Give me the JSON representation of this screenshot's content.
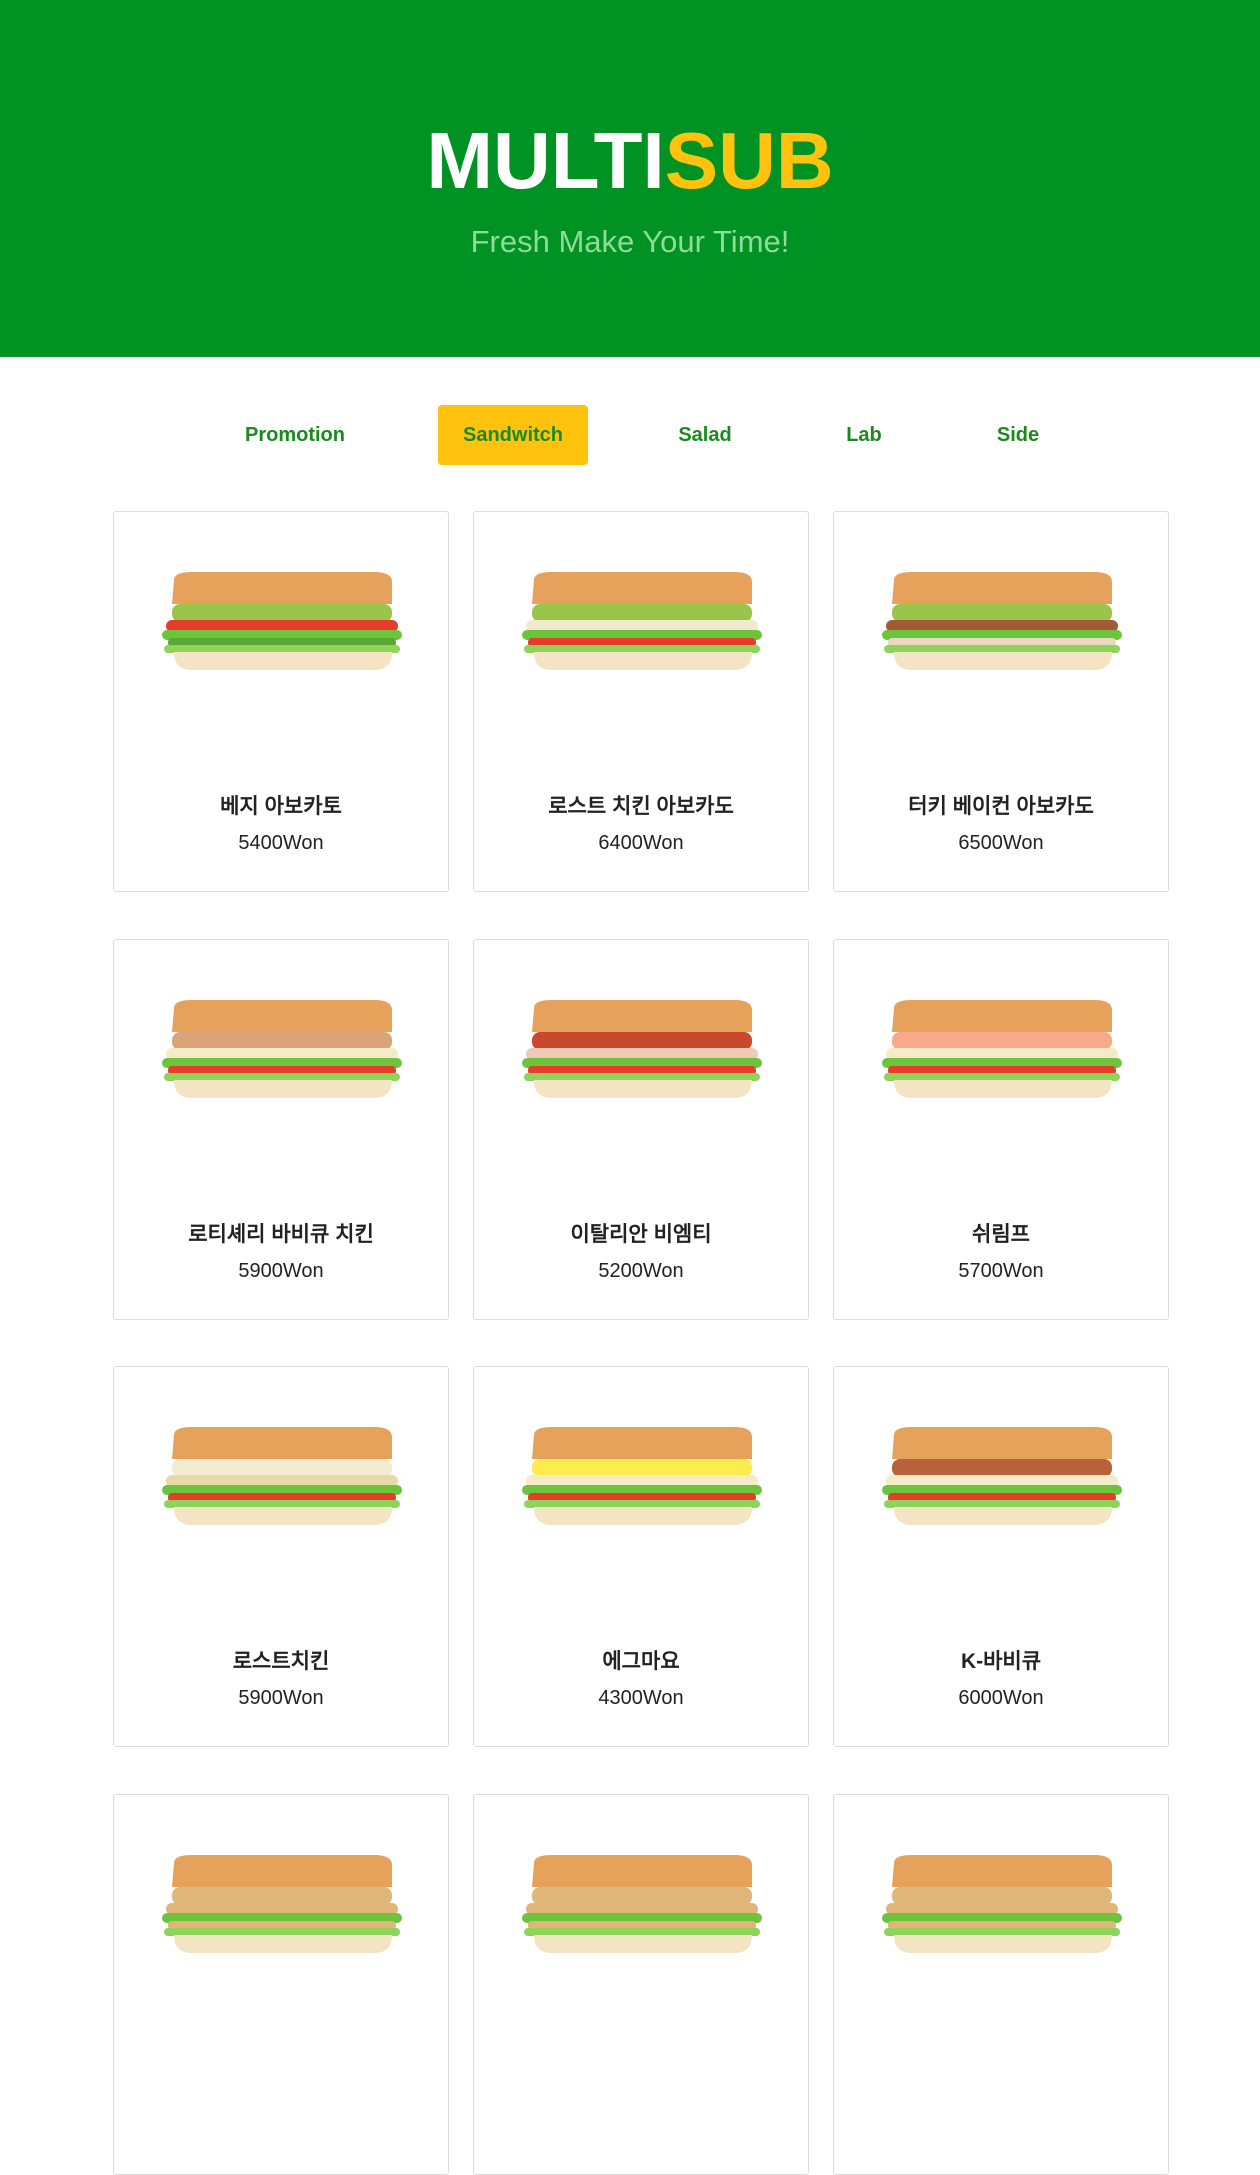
{
  "header": {
    "logo_part1": "MULTI",
    "logo_part2": "SUB",
    "tagline": "Fresh Make Your Time!",
    "bg_color": "#009223",
    "accent_color": "#ffc20e"
  },
  "tabs": [
    {
      "label": "Promotion",
      "active": false
    },
    {
      "label": "Sandwitch",
      "active": true
    },
    {
      "label": "Salad",
      "active": false
    },
    {
      "label": "Lab",
      "active": false
    },
    {
      "label": "Side",
      "active": false
    }
  ],
  "products": [
    {
      "name": "베지 아보카토",
      "price": "5400Won",
      "filling": "veggie-avocado"
    },
    {
      "name": "로스트 치킨 아보카도",
      "price": "6400Won",
      "filling": "chicken-avocado"
    },
    {
      "name": "터키 베이컨 아보카도",
      "price": "6500Won",
      "filling": "turkey-bacon-avocado"
    },
    {
      "name": "로티셰리 바비큐 치킨",
      "price": "5900Won",
      "filling": "rotisserie-bbq"
    },
    {
      "name": "이탈리안 비엠티",
      "price": "5200Won",
      "filling": "italian-bmt"
    },
    {
      "name": "쉬림프",
      "price": "5700Won",
      "filling": "shrimp"
    },
    {
      "name": "로스트치킨",
      "price": "5900Won",
      "filling": "roast-chicken"
    },
    {
      "name": "에그마요",
      "price": "4300Won",
      "filling": "egg-mayo"
    },
    {
      "name": "K-바비큐",
      "price": "6000Won",
      "filling": "k-bbq"
    },
    {
      "name": "",
      "price": "",
      "filling": "partial"
    },
    {
      "name": "",
      "price": "",
      "filling": "partial"
    },
    {
      "name": "",
      "price": "",
      "filling": "partial"
    }
  ]
}
